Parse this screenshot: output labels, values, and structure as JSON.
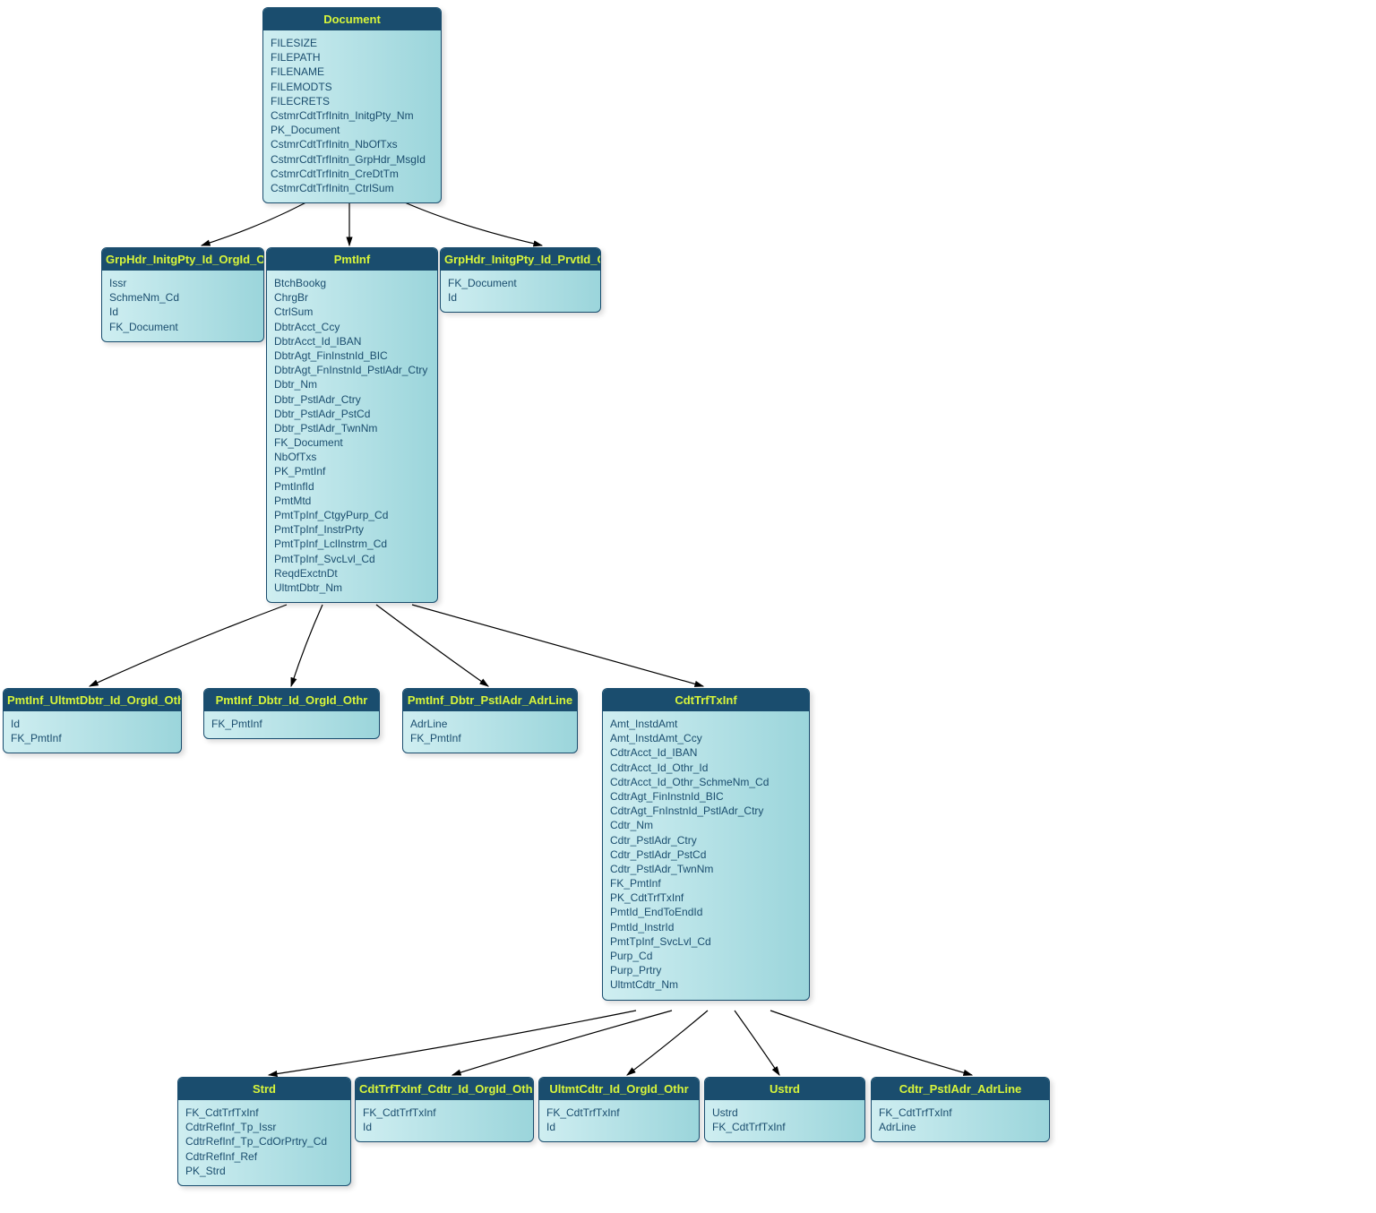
{
  "entities": {
    "document": {
      "title": "Document",
      "fields": [
        "FILESIZE",
        "FILEPATH",
        "FILENAME",
        "FILEMODTS",
        "FILECRETS",
        "CstmrCdtTrfInitn_InitgPty_Nm",
        "PK_Document",
        "CstmrCdtTrfInitn_NbOfTxs",
        "CstmrCdtTrfInitn_GrpHdr_MsgId",
        "CstmrCdtTrfInitn_CreDtTm",
        "CstmrCdtTrfInitn_CtrlSum"
      ]
    },
    "grpHdrOrgId": {
      "title": "GrpHdr_InitgPty_Id_OrgId_Othr",
      "fields": [
        "Issr",
        "SchmeNm_Cd",
        "Id",
        "FK_Document"
      ]
    },
    "pmtInf": {
      "title": "PmtInf",
      "fields": [
        "BtchBookg",
        "ChrgBr",
        "CtrlSum",
        "DbtrAcct_Ccy",
        "DbtrAcct_Id_IBAN",
        "DbtrAgt_FinInstnId_BIC",
        "DbtrAgt_FnInstnId_PstlAdr_Ctry",
        "Dbtr_Nm",
        "Dbtr_PstlAdr_Ctry",
        "Dbtr_PstlAdr_PstCd",
        "Dbtr_PstlAdr_TwnNm",
        "FK_Document",
        "NbOfTxs",
        "PK_PmtInf",
        "PmtInfId",
        "PmtMtd",
        "PmtTpInf_CtgyPurp_Cd",
        "PmtTpInf_InstrPrty",
        "PmtTpInf_LclInstrm_Cd",
        "PmtTpInf_SvcLvl_Cd",
        "ReqdExctnDt",
        "UltmtDbtr_Nm"
      ]
    },
    "grpHdrPrvtId": {
      "title": "GrpHdr_InitgPty_Id_PrvtId_Othr",
      "fields": [
        "FK_Document",
        "Id"
      ]
    },
    "pmtInfUltmtDbtrOrgId": {
      "title": "PmtInf_UltmtDbtr_Id_OrgId_Othr",
      "fields": [
        "Id",
        "FK_PmtInf"
      ]
    },
    "pmtInfDbtrOrgId": {
      "title": "PmtInf_Dbtr_Id_OrgId_Othr",
      "fields": [
        "FK_PmtInf"
      ]
    },
    "pmtInfDbtrAdrLine": {
      "title": "PmtInf_Dbtr_PstlAdr_AdrLine",
      "fields": [
        "AdrLine",
        "FK_PmtInf"
      ]
    },
    "cdtTrfTxInf": {
      "title": "CdtTrfTxInf",
      "fields": [
        "Amt_InstdAmt",
        "Amt_InstdAmt_Ccy",
        "CdtrAcct_Id_IBAN",
        "CdtrAcct_Id_Othr_Id",
        "CdtrAcct_Id_Othr_SchmeNm_Cd",
        "CdtrAgt_FinInstnId_BIC",
        "CdtrAgt_FnInstnId_PstlAdr_Ctry",
        "Cdtr_Nm",
        "Cdtr_PstlAdr_Ctry",
        "Cdtr_PstlAdr_PstCd",
        "Cdtr_PstlAdr_TwnNm",
        "FK_PmtInf",
        "PK_CdtTrfTxInf",
        "PmtId_EndToEndId",
        "PmtId_InstrId",
        "PmtTpInf_SvcLvl_Cd",
        "Purp_Cd",
        "Purp_Prtry",
        "UltmtCdtr_Nm"
      ]
    },
    "strd": {
      "title": "Strd",
      "fields": [
        "FK_CdtTrfTxInf",
        "CdtrRefInf_Tp_Issr",
        "CdtrRefInf_Tp_CdOrPrtry_Cd",
        "CdtrRefInf_Ref",
        "PK_Strd"
      ]
    },
    "cdtTrfCdtrOrgId": {
      "title": "CdtTrfTxInf_Cdtr_Id_OrgId_Othr",
      "fields": [
        "FK_CdtTrfTxInf",
        "Id"
      ]
    },
    "ultmtCdtrOrgId": {
      "title": "UltmtCdtr_Id_OrgId_Othr",
      "fields": [
        "FK_CdtTrfTxInf",
        "Id"
      ]
    },
    "ustrd": {
      "title": "Ustrd",
      "fields": [
        "Ustrd",
        "FK_CdtTrfTxInf"
      ]
    },
    "cdtrPstlAdrLine": {
      "title": "Cdtr_PstlAdr_AdrLine",
      "fields": [
        "FK_CdtTrfTxInf",
        "AdrLine"
      ]
    }
  }
}
